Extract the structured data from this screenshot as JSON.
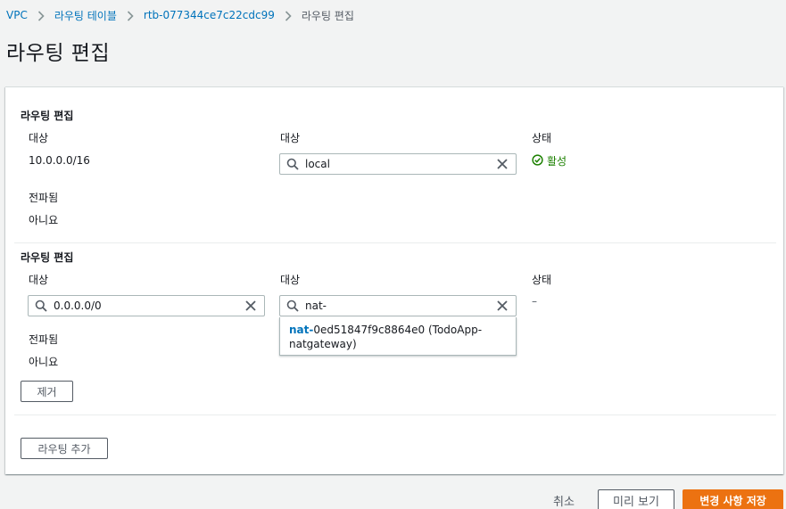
{
  "breadcrumb": {
    "items": [
      "VPC",
      "라우팅 테이블",
      "rtb-077344ce7c22cdc99"
    ],
    "current": "라우팅 편집"
  },
  "page_title": "라우팅 편집",
  "routes": [
    {
      "group_title": "라우팅 편집",
      "destination_label": "대상",
      "destination_value": "10.0.0.0/16",
      "target_label": "대상",
      "target_value": "local",
      "status_label": "상태",
      "status_value": "활성",
      "propagated_label": "전파됨",
      "propagated_value": "아니요"
    },
    {
      "group_title": "라우팅 편집",
      "destination_label": "대상",
      "destination_value": "0.0.0.0/0",
      "target_label": "대상",
      "target_value": "nat-",
      "status_label": "상태",
      "status_value": "–",
      "propagated_label": "전파됨",
      "propagated_value": "아니요",
      "remove_label": "제거"
    }
  ],
  "suggestion": {
    "match": "nat-",
    "rest_line1": "0ed51847f9c8864e0 (TodoApp-",
    "line2": "natgateway)"
  },
  "add_route_label": "라우팅 추가",
  "footer": {
    "cancel_label": "취소",
    "preview_label": "미리 보기",
    "save_label": "변경 사항 저장"
  },
  "colors": {
    "link": "#0073bb",
    "success": "#1d8102",
    "primary": "#ec7211"
  }
}
